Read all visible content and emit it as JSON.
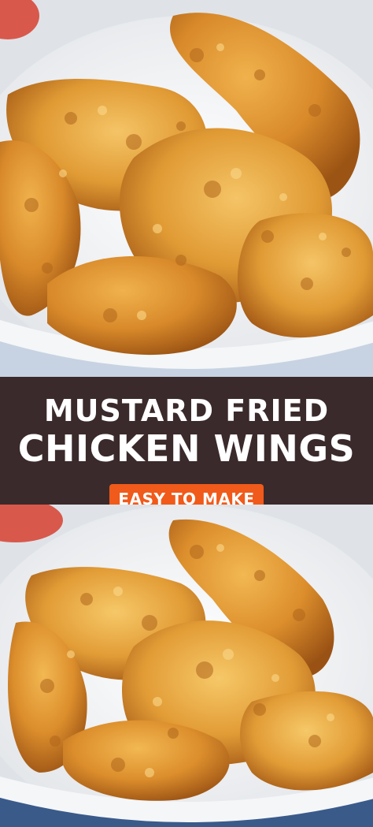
{
  "title": {
    "line1": "MUSTARD FRIED",
    "line2": "CHICKEN WINGS"
  },
  "badge": {
    "label": "EASY TO MAKE"
  },
  "colors": {
    "banner_bg": "#3b2a2b",
    "badge_bg": "#f05a1a",
    "text": "#ffffff"
  }
}
